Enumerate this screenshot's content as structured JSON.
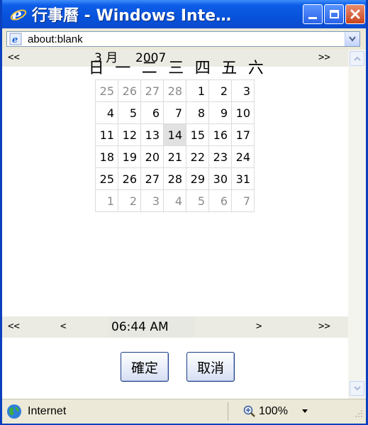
{
  "window": {
    "title": "行事曆 - Windows Inte…",
    "controls": {
      "minimize": "minimize",
      "maximize": "maximize",
      "close": "close"
    }
  },
  "address": {
    "url": "about:blank"
  },
  "calendar": {
    "prev_label": "<<",
    "next_label": ">>",
    "month": "3 月",
    "year": "2007",
    "weekdays": [
      "日",
      "一",
      "二",
      "三",
      "四",
      "五",
      "六"
    ],
    "weeks": [
      [
        {
          "d": "25",
          "other": true
        },
        {
          "d": "26",
          "other": true
        },
        {
          "d": "27",
          "other": true
        },
        {
          "d": "28",
          "other": true
        },
        {
          "d": "1"
        },
        {
          "d": "2"
        },
        {
          "d": "3"
        }
      ],
      [
        {
          "d": "4"
        },
        {
          "d": "5"
        },
        {
          "d": "6"
        },
        {
          "d": "7"
        },
        {
          "d": "8"
        },
        {
          "d": "9"
        },
        {
          "d": "10"
        }
      ],
      [
        {
          "d": "11"
        },
        {
          "d": "12"
        },
        {
          "d": "13"
        },
        {
          "d": "14",
          "today": true
        },
        {
          "d": "15"
        },
        {
          "d": "16"
        },
        {
          "d": "17"
        }
      ],
      [
        {
          "d": "18"
        },
        {
          "d": "19"
        },
        {
          "d": "20"
        },
        {
          "d": "21"
        },
        {
          "d": "22"
        },
        {
          "d": "23"
        },
        {
          "d": "24"
        }
      ],
      [
        {
          "d": "25"
        },
        {
          "d": "26"
        },
        {
          "d": "27"
        },
        {
          "d": "28"
        },
        {
          "d": "29"
        },
        {
          "d": "30"
        },
        {
          "d": "31"
        }
      ],
      [
        {
          "d": "1",
          "other": true
        },
        {
          "d": "2",
          "other": true
        },
        {
          "d": "3",
          "other": true
        },
        {
          "d": "4",
          "other": true
        },
        {
          "d": "5",
          "other": true
        },
        {
          "d": "6",
          "other": true
        },
        {
          "d": "7",
          "other": true
        }
      ]
    ]
  },
  "time": {
    "prev_big": "<<",
    "prev_small": "<",
    "value": "06:44 AM",
    "next_small": ">",
    "next_big": ">>"
  },
  "buttons": {
    "ok": "確定",
    "cancel": "取消"
  },
  "status": {
    "zone": "Internet",
    "zoom": "100%"
  },
  "colors": {
    "titlebar": "#0752da",
    "chrome": "#ece9d8",
    "today": "#e1e1e1",
    "nav_row": "#ecebe3"
  }
}
